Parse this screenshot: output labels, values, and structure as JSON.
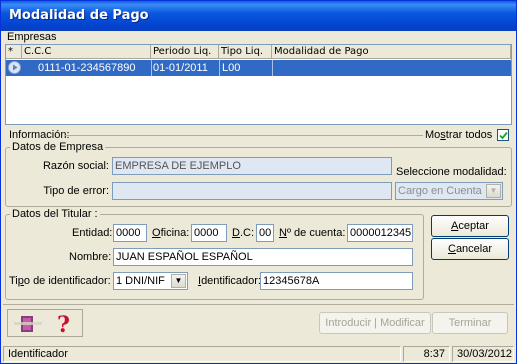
{
  "window": {
    "title": "Modalidad de Pago"
  },
  "empresas": {
    "group_label": "Empresas",
    "columns": {
      "marker": "*",
      "ccc": "C.C.C",
      "periodo": "Periodo Liq.",
      "tipo": "Tipo Liq.",
      "modalidad": "Modalidad de Pago"
    },
    "rows": [
      {
        "ccc": "0111-01-234567890",
        "periodo": "01-01/2011",
        "tipo": "L00",
        "modalidad": ""
      }
    ]
  },
  "info": {
    "label": "Información:",
    "mostrar_todos": "Mostrar todos",
    "mostrar_todos_checked": true
  },
  "datos_empresa": {
    "group_label": "Datos de Empresa",
    "razon_social_label": "Razón social:",
    "razon_social_value": "EMPRESA DE EJEMPLO",
    "tipo_error_label": "Tipo de error:",
    "tipo_error_value": "",
    "seleccione_label": "Seleccione modalidad:",
    "modalidad_value": "Cargo en Cuenta"
  },
  "datos_titular": {
    "group_label": "Datos del Titular :",
    "entidad_label": "Entidad:",
    "entidad_value": "0000",
    "oficina_label": "Oficina:",
    "oficina_value": "0000",
    "dc_label": "D.C:",
    "dc_value": "00",
    "cuenta_label": "Nº de cuenta:",
    "cuenta_value": "0000012345",
    "nombre_label": "Nombre:",
    "nombre_value": "JUAN ESPAÑOL ESPAÑOL",
    "tipo_ident_label": "Tipo de identificador:",
    "tipo_ident_value": "1 DNI/NIF",
    "identificador_label": "Identificador:",
    "identificador_value": "12345678A"
  },
  "buttons": {
    "aceptar": "Aceptar",
    "cancelar": "Cancelar",
    "introducir_modificar": "Introducir | Modificar",
    "terminar": "Terminar"
  },
  "statusbar": {
    "field": "Identificador",
    "time": "8:37",
    "date": "30/03/2012"
  },
  "icons": {
    "row_marker": "play-circle-icon",
    "tools": "toolbox-icon",
    "help": "help-icon",
    "checkbox": "check-icon"
  }
}
